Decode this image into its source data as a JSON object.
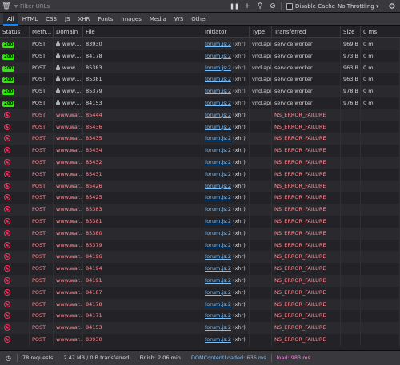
{
  "toolbar": {
    "filter_placeholder": "Filter URLs",
    "disable_cache_label": "Disable Cache",
    "throttling_label": "No Throttling ▾"
  },
  "type_tabs": [
    "All",
    "HTML",
    "CSS",
    "JS",
    "XHR",
    "Fonts",
    "Images",
    "Media",
    "WS",
    "Other"
  ],
  "columns": {
    "status": "Status",
    "method": "Meth...",
    "domain": "Domain",
    "file": "File",
    "initiator": "Initiator",
    "type": "Type",
    "transferred": "Transferred",
    "size": "Size",
    "waterfall": "0 ms"
  },
  "requests": [
    {
      "status": "200",
      "method": "POST",
      "domain": "www....",
      "secure": true,
      "file": "83930",
      "initiator": "forum.js:2",
      "initiator_type": "(xhr)",
      "type": "vnd.api",
      "transferred": "service worker",
      "size": "969 B",
      "timing": "0 m"
    },
    {
      "status": "200",
      "method": "POST",
      "domain": "www....",
      "secure": true,
      "file": "84178",
      "initiator": "forum.js:2",
      "initiator_type": "(xhr)",
      "type": "vnd.api",
      "transferred": "service worker",
      "size": "973 B",
      "timing": "0 m"
    },
    {
      "status": "200",
      "method": "POST",
      "domain": "www....",
      "secure": true,
      "file": "85383",
      "initiator": "forum.js:2",
      "initiator_type": "(xhr)",
      "type": "vnd.api",
      "transferred": "service worker",
      "size": "963 B",
      "timing": "0 m"
    },
    {
      "status": "200",
      "method": "POST",
      "domain": "www....",
      "secure": true,
      "file": "85381",
      "initiator": "forum.js:2",
      "initiator_type": "(xhr)",
      "type": "vnd.api",
      "transferred": "service worker",
      "size": "963 B",
      "timing": "0 m"
    },
    {
      "status": "200",
      "method": "POST",
      "domain": "www....",
      "secure": true,
      "file": "85379",
      "initiator": "forum.js:2",
      "initiator_type": "(xhr)",
      "type": "vnd.api",
      "transferred": "service worker",
      "size": "978 B",
      "timing": "0 m"
    },
    {
      "status": "200",
      "method": "POST",
      "domain": "www....",
      "secure": true,
      "file": "84153",
      "initiator": "forum.js:2",
      "initiator_type": "(xhr)",
      "type": "vnd.api",
      "transferred": "service worker",
      "size": "976 B",
      "timing": "0 m"
    },
    {
      "status": "blocked",
      "method": "POST",
      "domain": "www.war...",
      "file": "85444",
      "initiator": "forum.js:2",
      "initiator_type": "(xhr)",
      "transferred": "NS_ERROR_FAILURE"
    },
    {
      "status": "blocked",
      "method": "POST",
      "domain": "www.war...",
      "file": "85436",
      "initiator": "forum.js:2",
      "initiator_type": "(xhr)",
      "transferred": "NS_ERROR_FAILURE"
    },
    {
      "status": "blocked",
      "method": "POST",
      "domain": "www.war...",
      "file": "85435",
      "initiator": "forum.js:2",
      "initiator_type": "(xhr)",
      "transferred": "NS_ERROR_FAILURE"
    },
    {
      "status": "blocked",
      "method": "POST",
      "domain": "www.war...",
      "file": "85434",
      "initiator": "forum.js:2",
      "initiator_type": "(xhr)",
      "transferred": "NS_ERROR_FAILURE"
    },
    {
      "status": "blocked",
      "method": "POST",
      "domain": "www.war...",
      "file": "85432",
      "initiator": "forum.js:2",
      "initiator_type": "(xhr)",
      "transferred": "NS_ERROR_FAILURE"
    },
    {
      "status": "blocked",
      "method": "POST",
      "domain": "www.war...",
      "file": "85431",
      "initiator": "forum.js:2",
      "initiator_type": "(xhr)",
      "transferred": "NS_ERROR_FAILURE"
    },
    {
      "status": "blocked",
      "method": "POST",
      "domain": "www.war...",
      "file": "85426",
      "initiator": "forum.js:2",
      "initiator_type": "(xhr)",
      "transferred": "NS_ERROR_FAILURE"
    },
    {
      "status": "blocked",
      "method": "POST",
      "domain": "www.war...",
      "file": "85425",
      "initiator": "forum.js:2",
      "initiator_type": "(xhr)",
      "transferred": "NS_ERROR_FAILURE"
    },
    {
      "status": "blocked",
      "method": "POST",
      "domain": "www.war...",
      "file": "85383",
      "initiator": "forum.js:2",
      "initiator_type": "(xhr)",
      "transferred": "NS_ERROR_FAILURE"
    },
    {
      "status": "blocked",
      "method": "POST",
      "domain": "www.war...",
      "file": "85381",
      "initiator": "forum.js:2",
      "initiator_type": "(xhr)",
      "transferred": "NS_ERROR_FAILURE"
    },
    {
      "status": "blocked",
      "method": "POST",
      "domain": "www.war...",
      "file": "85380",
      "initiator": "forum.js:2",
      "initiator_type": "(xhr)",
      "transferred": "NS_ERROR_FAILURE"
    },
    {
      "status": "blocked",
      "method": "POST",
      "domain": "www.war...",
      "file": "85379",
      "initiator": "forum.js:2",
      "initiator_type": "(xhr)",
      "transferred": "NS_ERROR_FAILURE"
    },
    {
      "status": "blocked",
      "method": "POST",
      "domain": "www.war...",
      "file": "84196",
      "initiator": "forum.js:2",
      "initiator_type": "(xhr)",
      "transferred": "NS_ERROR_FAILURE"
    },
    {
      "status": "blocked",
      "method": "POST",
      "domain": "www.war...",
      "file": "84194",
      "initiator": "forum.js:2",
      "initiator_type": "(xhr)",
      "transferred": "NS_ERROR_FAILURE"
    },
    {
      "status": "blocked",
      "method": "POST",
      "domain": "www.war...",
      "file": "84191",
      "initiator": "forum.js:2",
      "initiator_type": "(xhr)",
      "transferred": "NS_ERROR_FAILURE"
    },
    {
      "status": "blocked",
      "method": "POST",
      "domain": "www.war...",
      "file": "84187",
      "initiator": "forum.js:2",
      "initiator_type": "(xhr)",
      "transferred": "NS_ERROR_FAILURE"
    },
    {
      "status": "blocked",
      "method": "POST",
      "domain": "www.war...",
      "file": "84178",
      "initiator": "forum.js:2",
      "initiator_type": "(xhr)",
      "transferred": "NS_ERROR_FAILURE"
    },
    {
      "status": "blocked",
      "method": "POST",
      "domain": "www.war...",
      "file": "84171",
      "initiator": "forum.js:2",
      "initiator_type": "(xhr)",
      "transferred": "NS_ERROR_FAILURE"
    },
    {
      "status": "blocked",
      "method": "POST",
      "domain": "www.war...",
      "file": "84153",
      "initiator": "forum.js:2",
      "initiator_type": "(xhr)",
      "transferred": "NS_ERROR_FAILURE"
    },
    {
      "status": "blocked",
      "method": "POST",
      "domain": "www.war...",
      "file": "83930",
      "initiator": "forum.js:2",
      "initiator_type": "(xhr)",
      "transferred": "NS_ERROR_FAILURE"
    }
  ],
  "statusbar": {
    "requests": "78 requests",
    "transferred": "2.47 MB / 0 B transferred",
    "finish": "Finish: 2.06 min",
    "dom_content_loaded": "DOMContentLoaded: 636 ms",
    "load": "load: 983 ms"
  },
  "colors": {
    "status_ok": "#30e60b",
    "status_error": "#ff2a5f",
    "error_text": "#ff8a94",
    "link": "#75bfff",
    "load": "#ff79e0"
  }
}
